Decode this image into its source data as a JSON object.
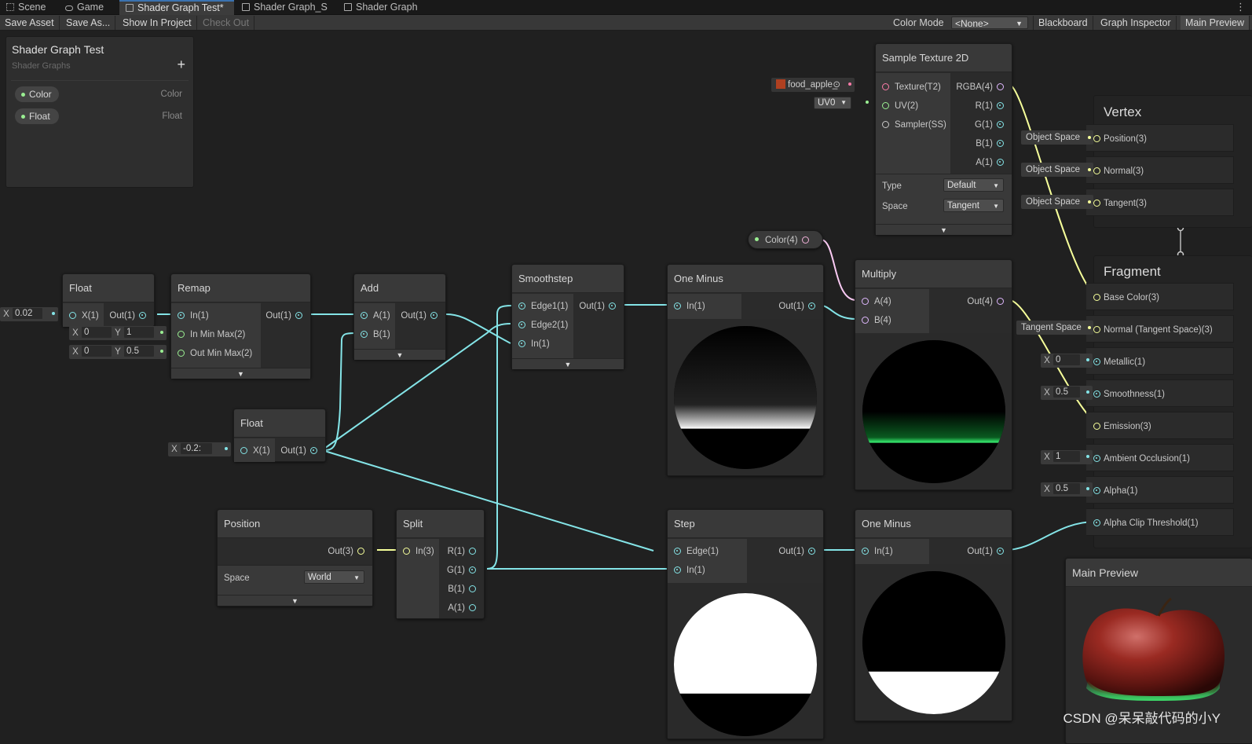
{
  "tabs": [
    {
      "label": "Scene"
    },
    {
      "label": "Game"
    },
    {
      "label": "Shader Graph Test*"
    },
    {
      "label": "Shader Graph_S"
    },
    {
      "label": "Shader Graph"
    }
  ],
  "toolbar": {
    "save_asset": "Save Asset",
    "save_as": "Save As...",
    "show_in_project": "Show In Project",
    "check_out": "Check Out",
    "color_mode_label": "Color Mode",
    "color_mode_value": "<None>",
    "blackboard": "Blackboard",
    "graph_inspector": "Graph Inspector",
    "main_preview": "Main Preview"
  },
  "blackboard": {
    "title": "Shader Graph Test",
    "subtitle": "Shader Graphs",
    "add": "+",
    "properties": [
      {
        "name": "Color",
        "type": "Color"
      },
      {
        "name": "Float",
        "type": "Float"
      }
    ]
  },
  "nodes": {
    "float1": {
      "title": "Float",
      "input_label": "X(1)",
      "output_label": "Out(1)",
      "field_k": "X",
      "field_v": "0.02"
    },
    "remap": {
      "title": "Remap",
      "inputs": [
        "In(1)",
        "In Min Max(2)",
        "Out Min Max(2)"
      ],
      "output": "Out(1)",
      "inmin_x": "0",
      "inmin_y": "1",
      "outmin_x": "0",
      "outmin_y": "0.5",
      "k_x": "X",
      "k_y": "Y"
    },
    "add": {
      "title": "Add",
      "inputs": [
        "A(1)",
        "B(1)"
      ],
      "output": "Out(1)"
    },
    "float2": {
      "title": "Float",
      "input_label": "X(1)",
      "output_label": "Out(1)",
      "field_k": "X",
      "field_v": "-0.2:"
    },
    "smoothstep": {
      "title": "Smoothstep",
      "inputs": [
        "Edge1(1)",
        "Edge2(1)",
        "In(1)"
      ],
      "output": "Out(1)"
    },
    "oneminus1": {
      "title": "One Minus",
      "input": "In(1)",
      "output": "Out(1)"
    },
    "multiply": {
      "title": "Multiply",
      "inputs": [
        "A(4)",
        "B(4)"
      ],
      "output": "Out(4)"
    },
    "sampletex": {
      "title": "Sample Texture 2D",
      "inputs": [
        "Texture(T2)",
        "UV(2)",
        "Sampler(SS)"
      ],
      "outputs": [
        "RGBA(4)",
        "R(1)",
        "G(1)",
        "B(1)",
        "A(1)"
      ],
      "type_label": "Type",
      "type_value": "Default",
      "space_label": "Space",
      "space_value": "Tangent",
      "texture_field": "food_apple_",
      "uv_field": "UV0"
    },
    "colorprop": {
      "label": "Color(4)"
    },
    "position": {
      "title": "Position",
      "output": "Out(3)",
      "space_label": "Space",
      "space_value": "World"
    },
    "split": {
      "title": "Split",
      "input": "In(3)",
      "outputs": [
        "R(1)",
        "G(1)",
        "B(1)",
        "A(1)"
      ]
    },
    "step": {
      "title": "Step",
      "inputs": [
        "Edge(1)",
        "In(1)"
      ],
      "output": "Out(1)"
    },
    "oneminus2": {
      "title": "One Minus",
      "input": "In(1)",
      "output": "Out(1)"
    }
  },
  "master": {
    "vertex_title": "Vertex",
    "vertex": [
      {
        "label": "Position(3)",
        "tag": "Object Space"
      },
      {
        "label": "Normal(3)",
        "tag": "Object Space"
      },
      {
        "label": "Tangent(3)",
        "tag": "Object Space"
      }
    ],
    "fragment_title": "Fragment",
    "fragment": [
      {
        "label": "Base Color(3)"
      },
      {
        "label": "Normal (Tangent Space)(3)",
        "tag": "Tangent Space"
      },
      {
        "label": "Metallic(1)",
        "k": "X",
        "v": "0"
      },
      {
        "label": "Smoothness(1)",
        "k": "X",
        "v": "0.5"
      },
      {
        "label": "Emission(3)"
      },
      {
        "label": "Ambient Occlusion(1)",
        "k": "X",
        "v": "1"
      },
      {
        "label": "Alpha(1)",
        "k": "X",
        "v": "0.5"
      },
      {
        "label": "Alpha Clip Threshold(1)"
      }
    ]
  },
  "main_preview": {
    "title": "Main Preview"
  },
  "watermark": "CSDN @呆呆敲代码的小Y",
  "colors": {
    "float_wire": "#84e4e7",
    "vec3_wire": "#f6ff9a",
    "vec4_wire": "#fbcbf4",
    "tex_port": "#fb7ba8",
    "bg": "#202020"
  }
}
